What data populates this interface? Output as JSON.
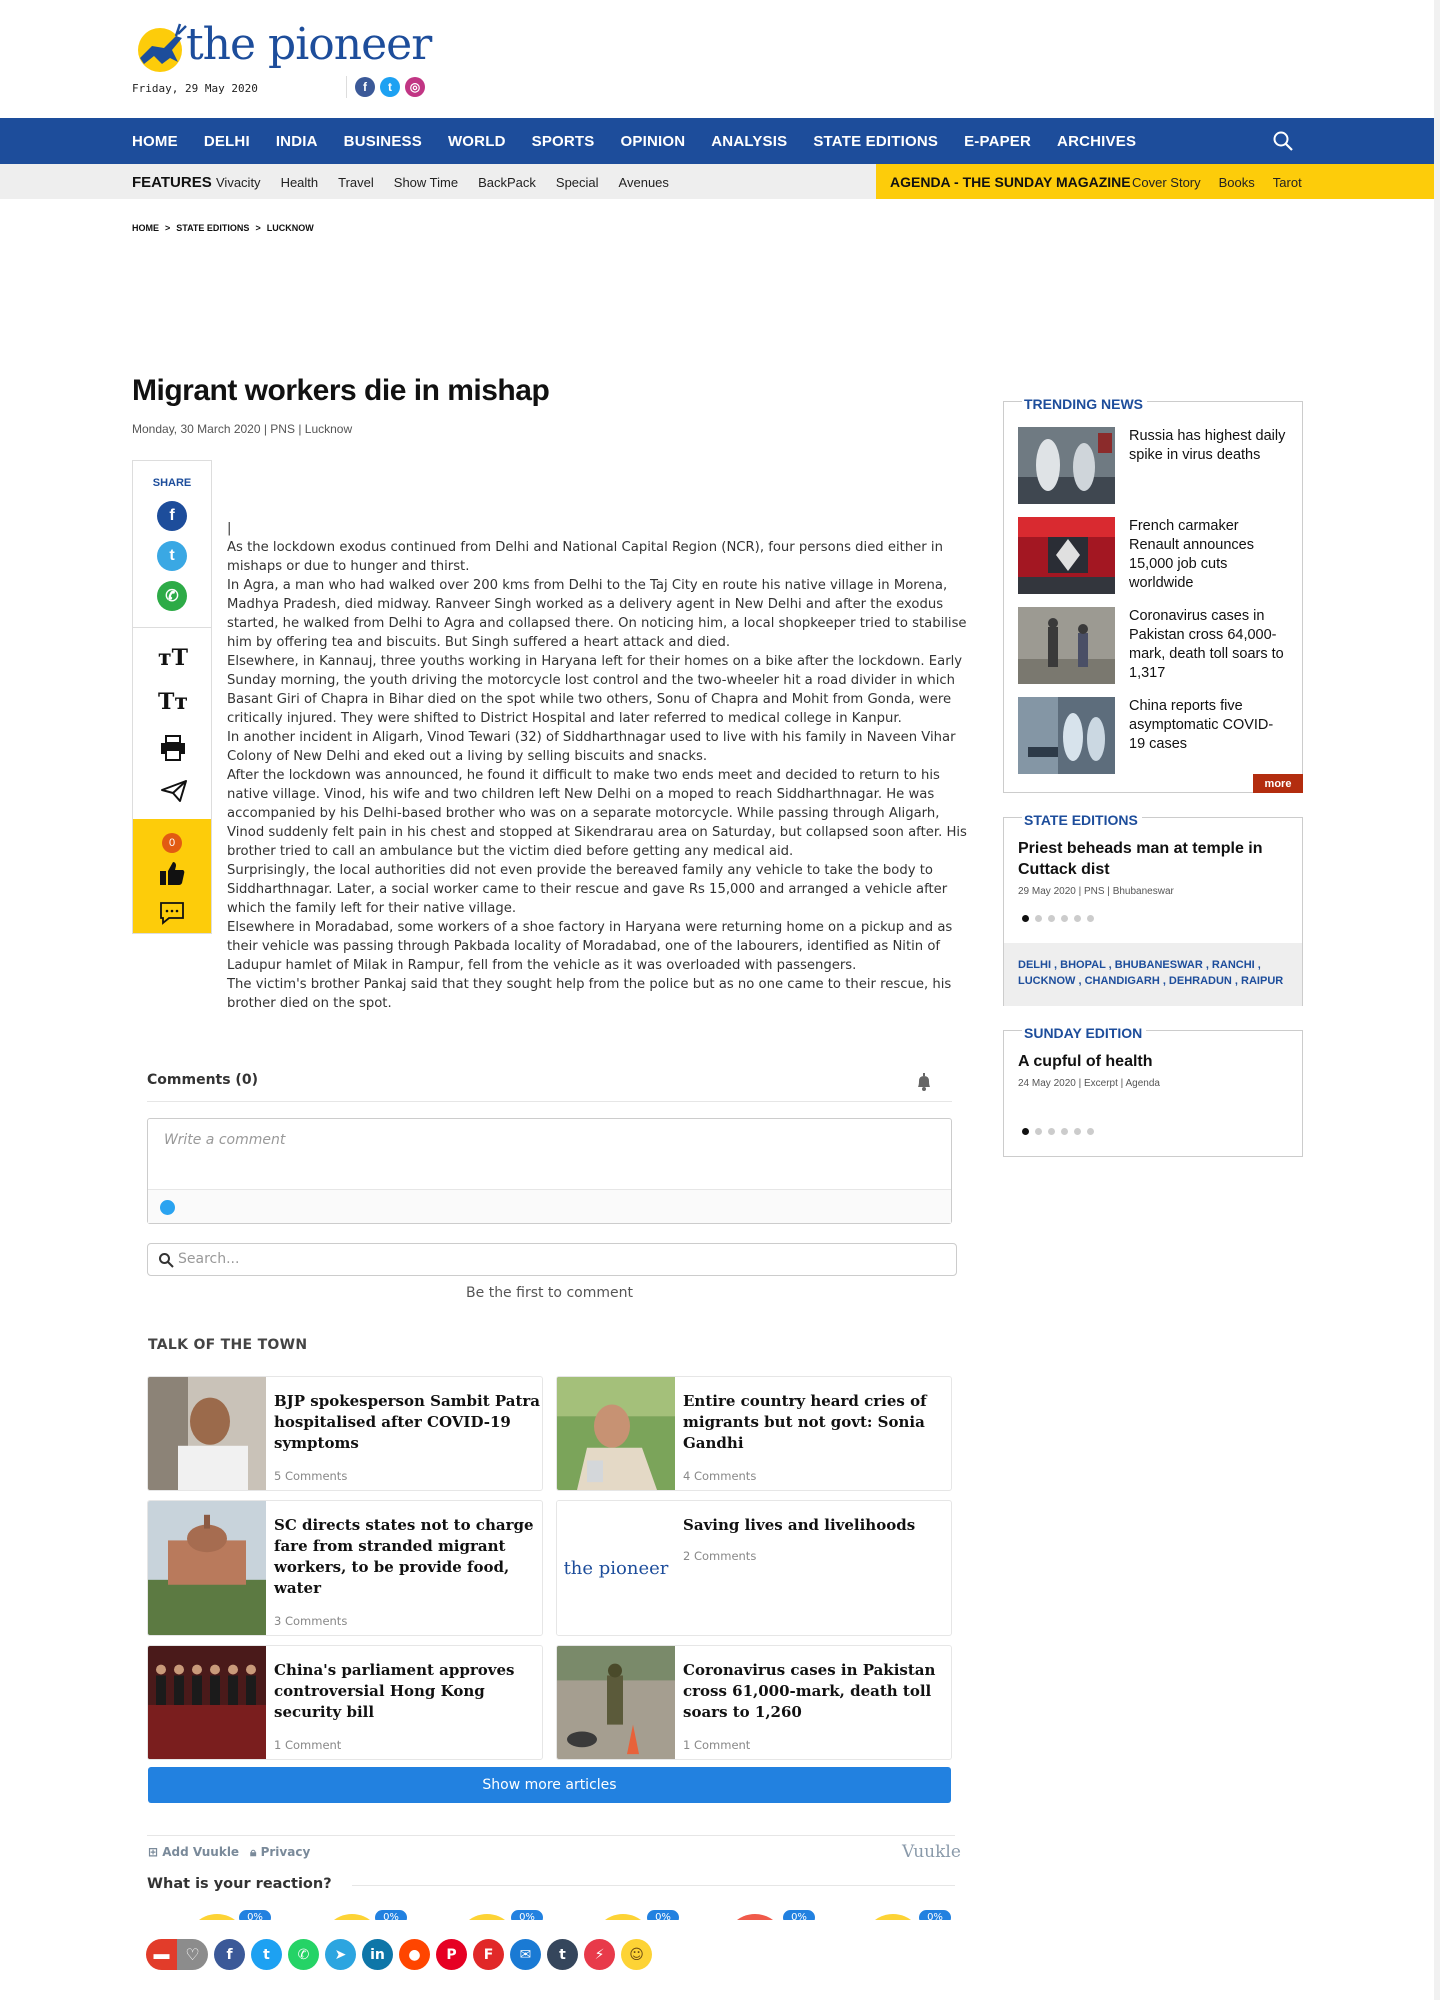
{
  "header": {
    "logo_text": "the pioneer",
    "date": "Friday, 29 May 2020",
    "social": [
      "facebook-icon",
      "twitter-icon",
      "instagram-icon"
    ]
  },
  "nav": {
    "items": [
      "HOME",
      "DELHI",
      "INDIA",
      "BUSINESS",
      "WORLD",
      "SPORTS",
      "OPINION",
      "ANALYSIS",
      "STATE EDITIONS",
      "E-PAPER",
      "ARCHIVES"
    ]
  },
  "subnav": {
    "features_label": "FEATURES",
    "features": [
      "Vivacity",
      "Health",
      "Travel",
      "Show Time",
      "BackPack",
      "Special",
      "Avenues"
    ],
    "agenda_label": "AGENDA - THE SUNDAY MAGAZINE",
    "agenda_links": [
      "Cover Story",
      "Books",
      "Tarot"
    ]
  },
  "breadcrumb": [
    "HOME",
    ">",
    "STATE EDITIONS",
    ">",
    "LUCKNOW"
  ],
  "article": {
    "title": "Migrant workers die in mishap",
    "meta": "Monday, 30 March 2020 | PNS | Lucknow",
    "share_label": "SHARE",
    "reaction_count": "0",
    "paragraphs": [
      "|",
      "As the lockdown exodus continued from Delhi and National Capital Region (NCR), four persons died either in mishaps or due to hunger and thirst.",
      "In Agra, a man who had walked over 200 kms from Delhi to the Taj City en route his native village in Morena, Madhya Pradesh, died midway. Ranveer Singh worked as a delivery agent in New Delhi and after the exodus started, he walked from Delhi to Agra and collapsed there. On noticing him, a local shopkeeper tried to stabilise him by offering tea and biscuits. But Singh suffered a heart attack and died.",
      "Elsewhere, in Kannauj, three youths working in Haryana left for their homes on a bike after the lockdown. Early Sunday morning, the youth driving the motorcycle lost control and the two-wheeler hit a road divider in which Basant Giri of Chapra in Bihar died on the spot while two others, Sonu of Chapra and Mohit from Gonda, were critically injured. They were shifted to District Hospital and later referred to medical college in Kanpur.",
      "In another incident in Aligarh, Vinod Tewari (32) of Siddharthnagar used to live with his family in Naveen Vihar Colony of New Delhi and eked out a living by selling biscuits and snacks.",
      "After the lockdown was announced, he found it difficult to make two ends meet and decided to return to his native village. Vinod, his wife and two children left New Delhi on a moped to reach Siddharthnagar. He was accompanied by his Delhi-based brother who was on a separate motorcycle. While passing through Aligarh, Vinod suddenly felt pain in his chest and stopped at Sikendrarau area on Saturday, but collapsed soon after. His brother tried to call an ambulance but the victim died before getting any medical aid.",
      "Surprisingly, the local authorities did not even provide the bereaved family any vehicle to take the body to Siddharthnagar. Later, a social worker came to their rescue and gave Rs 15,000 and arranged a vehicle after which the family left for their native village.",
      "Elsewhere in Moradabad, some workers of a shoe factory in Haryana were returning home on a pickup and as their vehicle was passing through Pakbada locality of Moradabad, one of the labourers, identified as Nitin of Ladupur hamlet of Milak in Rampur, fell from the vehicle as it was overloaded with passengers.",
      "The victim's brother Pankaj said  that they sought help from the police but as no one came to their rescue, his brother died on the spot."
    ]
  },
  "sidebar": {
    "trending_title": "TRENDING NEWS",
    "trending": [
      "Russia has highest daily spike in virus deaths",
      "French carmaker Renault announces 15,000 job cuts worldwide",
      "Coronavirus cases in Pakistan cross 64,000-mark, death toll soars to 1,317",
      "China reports five asymptomatic COVID-19 cases"
    ],
    "more_label": "more",
    "state_title": "STATE EDITIONS",
    "state_headline": "Priest beheads man at temple in Cuttack dist",
    "state_meta": "29 May 2020 | PNS | Bhubaneswar",
    "cities_line1": "DELHI , BHOPAL , BHUBANESWAR , RANCHI ,",
    "cities_line2": "LUCKNOW , CHANDIGARH , DEHRADUN , RAIPUR",
    "sunday_title": "SUNDAY EDITION",
    "sunday_headline": "A cupful of health",
    "sunday_meta": "24 May 2020 | Excerpt | Agenda"
  },
  "comments": {
    "heading": "Comments (0)",
    "placeholder": "Write a comment",
    "search_placeholder": "Search...",
    "empty_text": "Be the first to comment"
  },
  "talk_of_town": {
    "title": "TALK OF THE TOWN",
    "cards": [
      {
        "headline": "BJP spokesperson Sambit Patra hospitalised after COVID-19 symptoms",
        "comments": "5 Comments"
      },
      {
        "headline": "Entire country heard cries of migrants but not govt: Sonia Gandhi",
        "comments": "4 Comments"
      },
      {
        "headline": "SC directs states not to charge fare from stranded migrant workers, to be provide food, water",
        "comments": "3 Comments"
      },
      {
        "headline": "Saving lives and livelihoods",
        "comments": "2 Comments"
      },
      {
        "headline": "China's parliament approves controversial Hong Kong security bill",
        "comments": "1 Comment"
      },
      {
        "headline": "Coronavirus cases in Pakistan cross 61,000-mark, death toll soars to 1,260",
        "comments": "1 Comment"
      }
    ],
    "thumb_logo_text": "the pioneer",
    "show_more": "Show more articles"
  },
  "vuukle": {
    "add_label": "Add Vuukle",
    "privacy_label": "Privacy",
    "brand": "Vuukle",
    "reaction_question": "What is your reaction?",
    "percentages": [
      "0%",
      "0%",
      "0%",
      "0%",
      "0%",
      "0%"
    ]
  },
  "share_row": [
    "facebook-icon",
    "twitter-icon",
    "whatsapp-icon",
    "telegram-icon",
    "linkedin-icon",
    "reddit-icon",
    "pinterest-icon",
    "flipboard-icon",
    "email-icon",
    "tumblr-icon",
    "messenger-icon",
    "emoji-icon"
  ],
  "colors": {
    "brand_blue": "#1d4d9b",
    "agenda_yellow": "#fdcc0a",
    "button_blue": "#2281e0"
  }
}
